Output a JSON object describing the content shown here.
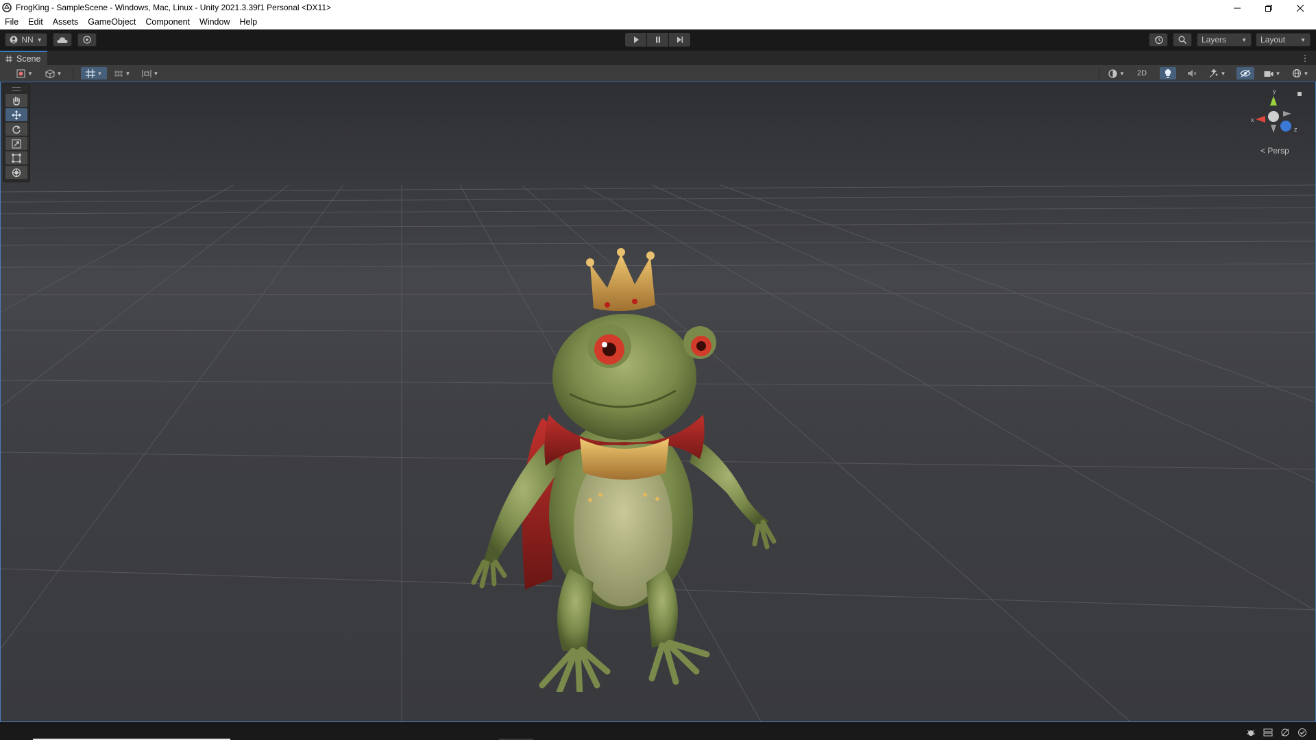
{
  "window": {
    "title": "FrogKing - SampleScene - Windows, Mac, Linux - Unity 2021.3.39f1 Personal <DX11>"
  },
  "menu": {
    "items": [
      "File",
      "Edit",
      "Assets",
      "GameObject",
      "Component",
      "Window",
      "Help"
    ]
  },
  "toolbar": {
    "account_label": "NN",
    "layers_label": "Layers",
    "layout_label": "Layout"
  },
  "scene": {
    "tab_label": "Scene",
    "toggle_2d_label": "2D",
    "persp_label": "Persp",
    "gizmo_axes": {
      "x": "x",
      "y": "y",
      "z": "z"
    }
  },
  "tools": [
    "hand-tool",
    "move-tool",
    "rotate-tool",
    "scale-tool",
    "rect-tool",
    "transform-tool"
  ],
  "active_tool": "move-tool",
  "colors": {
    "accent": "#46607c",
    "selection_border": "#4a7fbf",
    "axis_x": "#e0453c",
    "axis_y": "#9bd13c",
    "axis_z": "#3a79d8"
  }
}
